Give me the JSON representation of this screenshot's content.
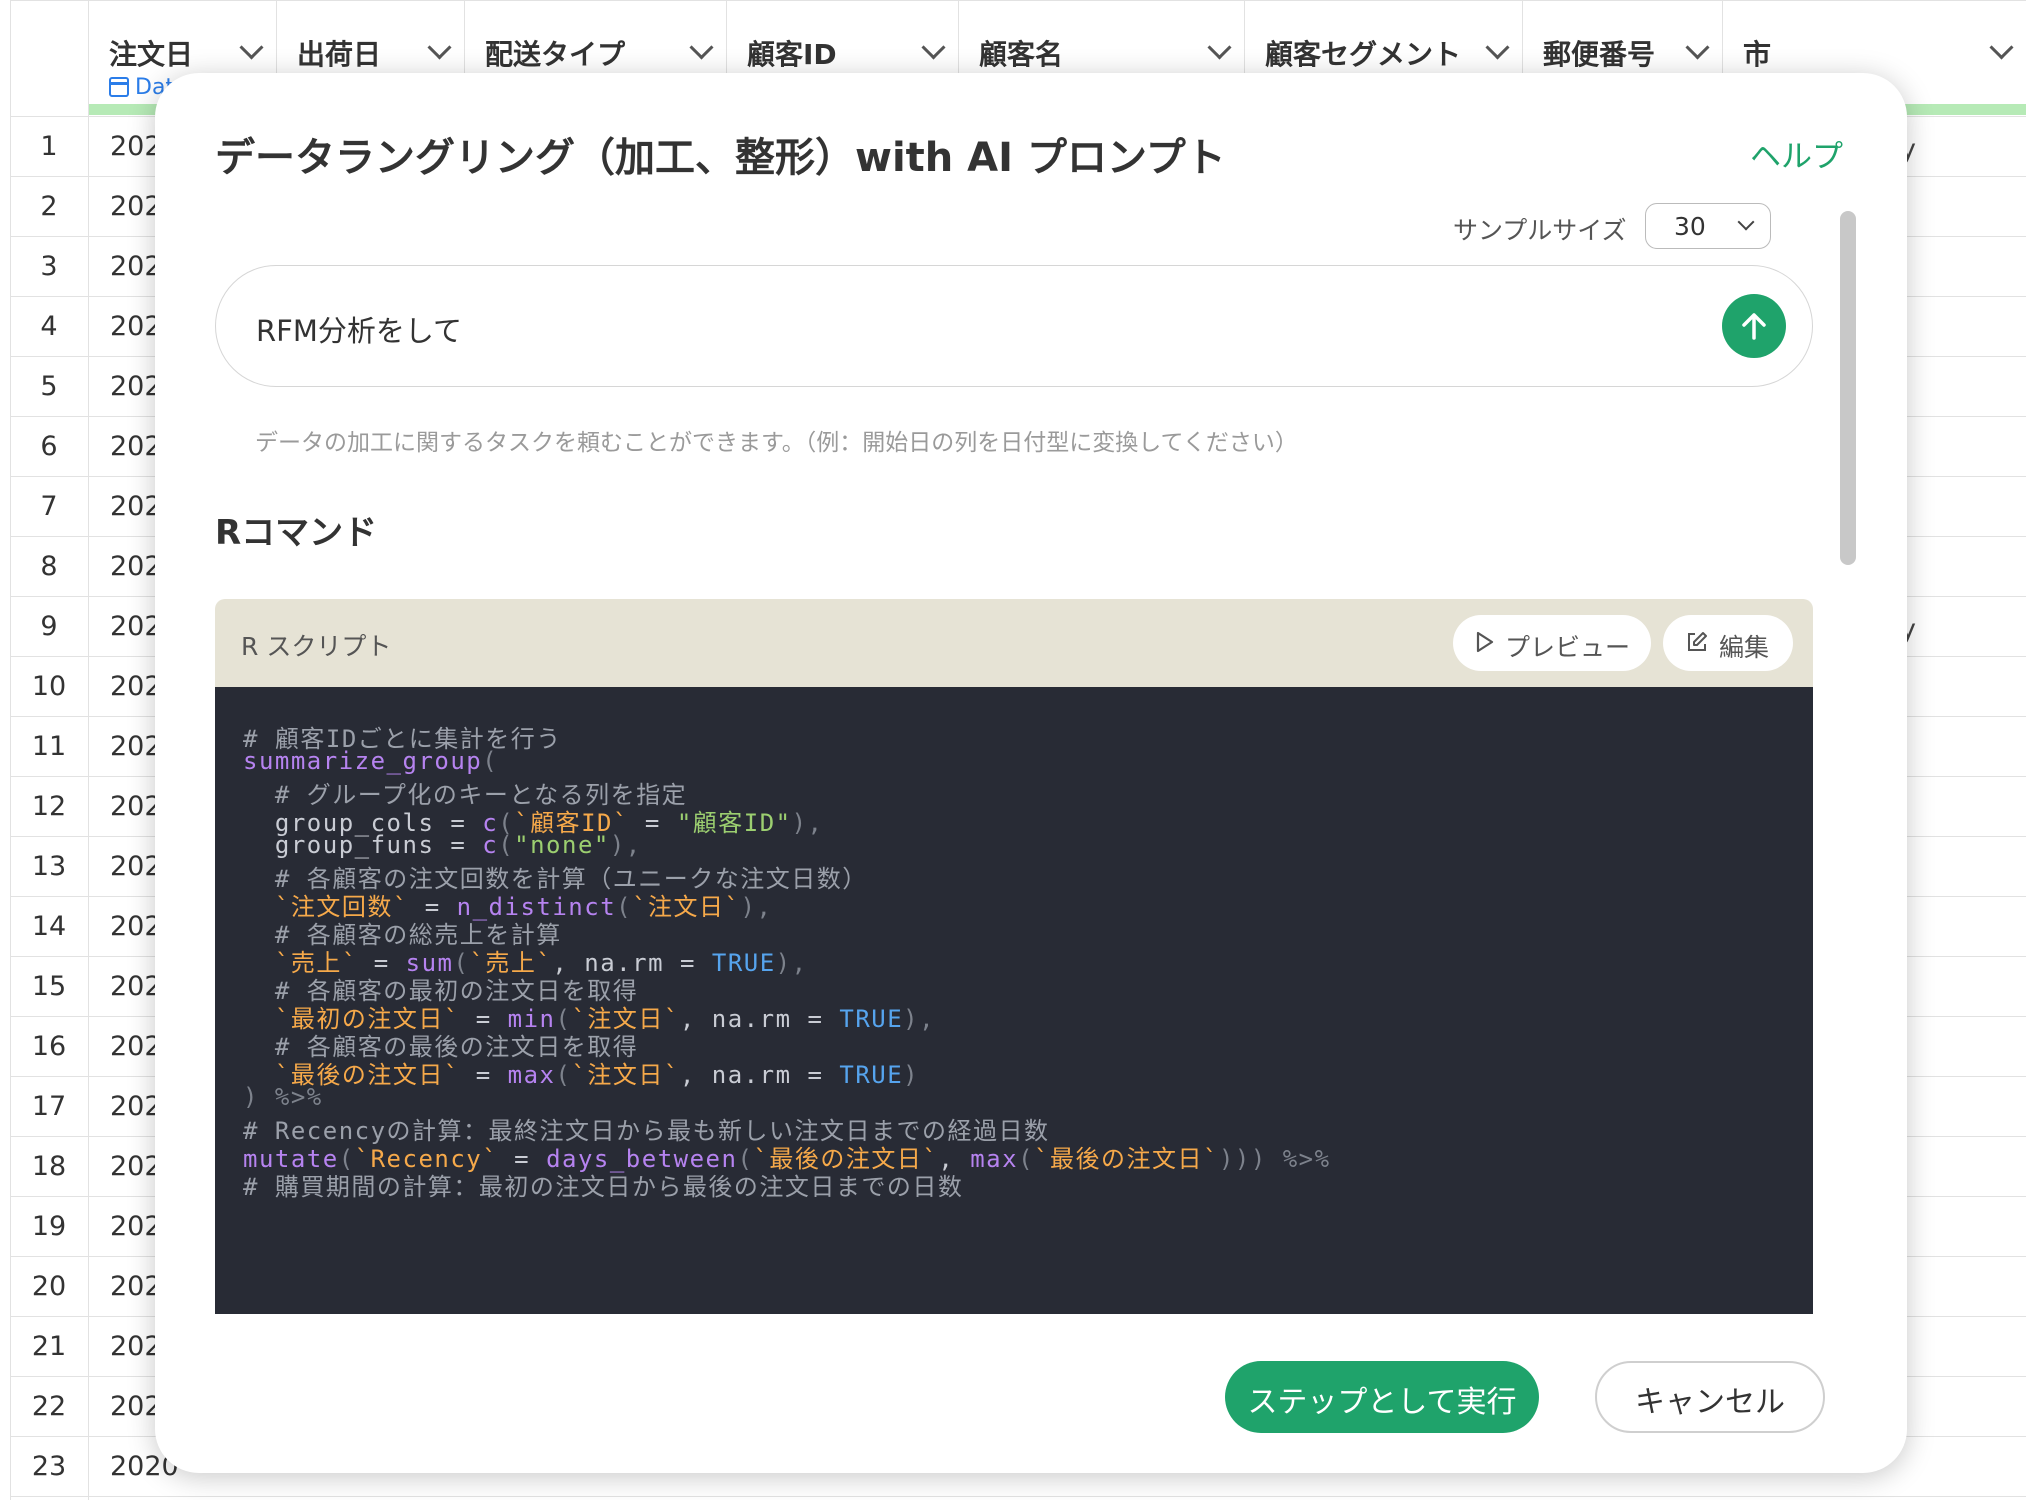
{
  "table": {
    "columns": [
      {
        "label": "注文日",
        "type_label": "Dat"
      },
      {
        "label": "出荷日"
      },
      {
        "label": "配送タイプ"
      },
      {
        "label": "顧客ID"
      },
      {
        "label": "顧客名"
      },
      {
        "label": "顧客セグメント"
      },
      {
        "label": "郵便番号"
      },
      {
        "label": "市"
      }
    ],
    "rows": [
      {
        "n": "1",
        "date": "202"
      },
      {
        "n": "2",
        "date": "202"
      },
      {
        "n": "3",
        "date": "202"
      },
      {
        "n": "4",
        "date": "202"
      },
      {
        "n": "5",
        "date": "202"
      },
      {
        "n": "6",
        "date": "202"
      },
      {
        "n": "7",
        "date": "202"
      },
      {
        "n": "8",
        "date": "202"
      },
      {
        "n": "9",
        "date": "202"
      },
      {
        "n": "10",
        "date": "202"
      },
      {
        "n": "11",
        "date": "202"
      },
      {
        "n": "12",
        "date": "202"
      },
      {
        "n": "13",
        "date": "202"
      },
      {
        "n": "14",
        "date": "202"
      },
      {
        "n": "15",
        "date": "202"
      },
      {
        "n": "16",
        "date": "202"
      },
      {
        "n": "17",
        "date": "202"
      },
      {
        "n": "18",
        "date": "202"
      },
      {
        "n": "19",
        "date": "202"
      },
      {
        "n": "20",
        "date": "202"
      },
      {
        "n": "21",
        "date": "202"
      },
      {
        "n": "22",
        "date": "202"
      },
      {
        "n": "23",
        "date": "2020-"
      }
    ],
    "peek_right": [
      "y",
      "y"
    ]
  },
  "modal": {
    "title": "データラングリング（加工、整形）with AI プロンプト",
    "help": "ヘルプ",
    "sample_size_label": "サンプルサイズ",
    "sample_size_value": "30",
    "prompt_value": "RFM分析をして",
    "prompt_hint": "データの加工に関するタスクを頼むことができます。（例：開始日の列を日付型に変換してください）",
    "section_title": "Rコマンド",
    "script_label": "R スクリプト",
    "preview_button": "プレビュー",
    "edit_button": "編集",
    "run_button": "ステップとして実行",
    "cancel_button": "キャンセル",
    "code": {
      "l1": "# 顧客IDごとに集計を行う",
      "l2_fn": "summarize_group",
      "l2_p": "(",
      "l3": "  # グループ化のキーとなる列を指定",
      "l4_a": "  group_cols = ",
      "l4_fn": "c",
      "l4_p1": "(",
      "l4_bt": "`顧客ID`",
      "l4_eq": " = ",
      "l4_str": "\"顧客ID\"",
      "l4_p2": "),",
      "l5_a": "  group_funs = ",
      "l5_fn": "c",
      "l5_p1": "(",
      "l5_str": "\"none\"",
      "l5_p2": "),",
      "l6": "  # 各顧客の注文回数を計算（ユニークな注文日数）",
      "l7_bt": "  `注文回数`",
      "l7_eq": " = ",
      "l7_fn": "n_distinct",
      "l7_p1": "(",
      "l7_bt2": "`注文日`",
      "l7_p2": "),",
      "l8": "  # 各顧客の総売上を計算",
      "l9_bt": "  `売上`",
      "l9_eq": " = ",
      "l9_fn": "sum",
      "l9_p1": "(",
      "l9_bt2": "`売上`",
      "l9_mid": ", na.rm = ",
      "l9_kw": "TRUE",
      "l9_p2": "),",
      "l10": "  # 各顧客の最初の注文日を取得",
      "l11_bt": "  `最初の注文日`",
      "l11_eq": " = ",
      "l11_fn": "min",
      "l11_p1": "(",
      "l11_bt2": "`注文日`",
      "l11_mid": ", na.rm = ",
      "l11_kw": "TRUE",
      "l11_p2": "),",
      "l12": "  # 各顧客の最後の注文日を取得",
      "l13_bt": "  `最後の注文日`",
      "l13_eq": " = ",
      "l13_fn": "max",
      "l13_p1": "(",
      "l13_bt2": "`注文日`",
      "l13_mid": ", na.rm = ",
      "l13_kw": "TRUE",
      "l13_p2": ")",
      "l14_p": ") ",
      "l14_pipe": "%>%",
      "l15": "# Recencyの計算：最終注文日から最も新しい注文日までの経過日数",
      "l16_fn": "mutate",
      "l16_p1": "(",
      "l16_bt": "`Recency`",
      "l16_eq": " = ",
      "l16_fn2": "days_between",
      "l16_p2": "(",
      "l16_bt2": "`最後の注文日`",
      "l16_c": ", ",
      "l16_fn3": "max",
      "l16_p3": "(",
      "l16_bt3": "`最後の注文日`",
      "l16_p4": "))) ",
      "l16_pipe": "%>%",
      "l17": "# 購買期間の計算：最初の注文日から最後の注文日までの日数"
    }
  },
  "colors": {
    "accent_green": "#1fa36b",
    "code_bg": "#282b35",
    "script_header_bg": "#e6e3d5",
    "date_type_blue": "#2b7de9"
  },
  "icons": [
    "calendar-icon",
    "send-arrow-icon",
    "play-icon",
    "edit-icon",
    "chevron-down-icon"
  ]
}
